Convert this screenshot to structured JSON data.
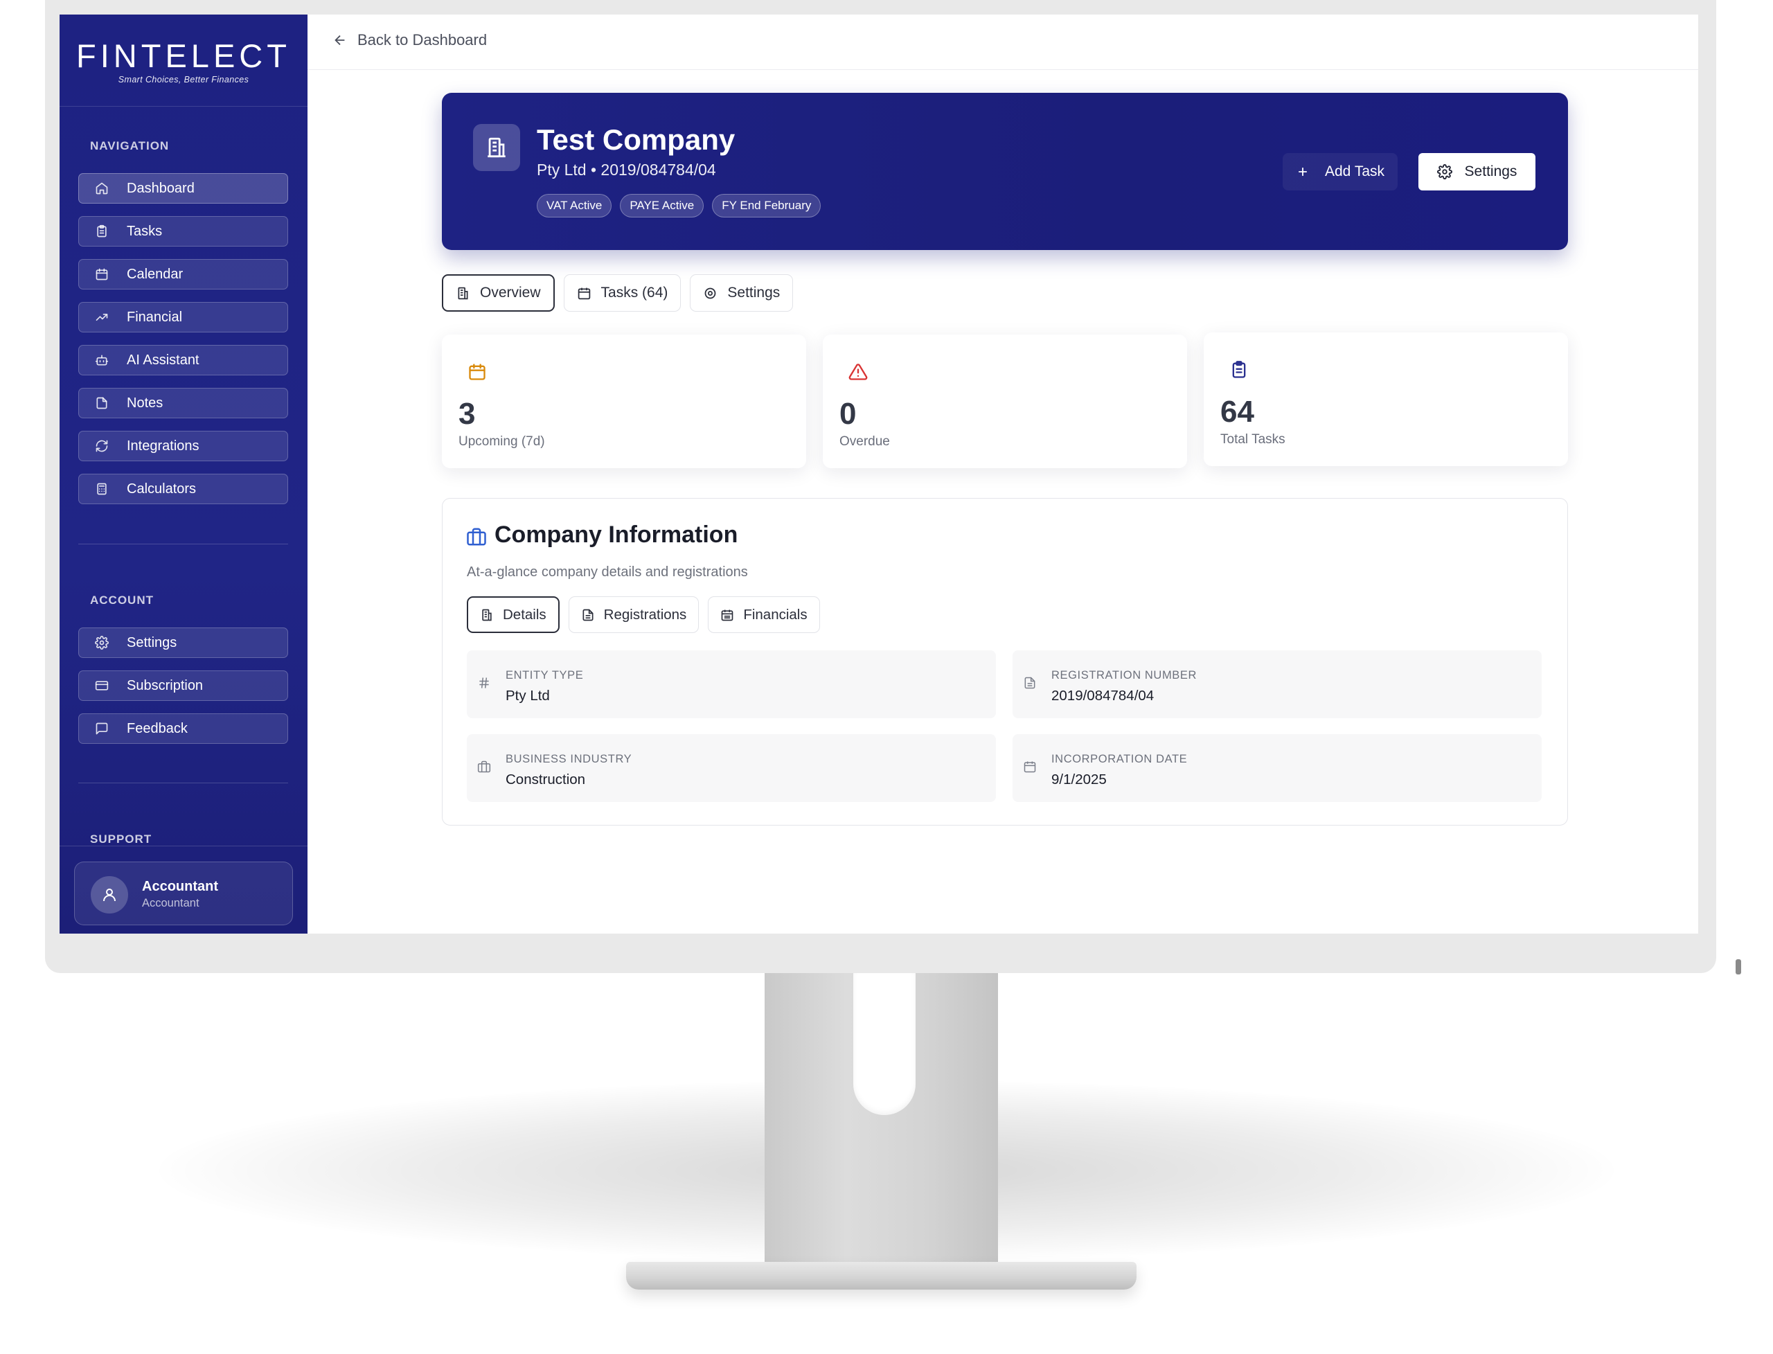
{
  "brand": {
    "name": "FINTELECT",
    "tagline": "Smart Choices, Better Finances"
  },
  "sidebar": {
    "navigation_label": "NAVIGATION",
    "nav_items": [
      {
        "label": "Dashboard",
        "icon": "home-icon",
        "active": true
      },
      {
        "label": "Tasks",
        "icon": "clipboard-icon"
      },
      {
        "label": "Calendar",
        "icon": "calendar-icon"
      },
      {
        "label": "Financial",
        "icon": "trending-up-icon"
      },
      {
        "label": "AI Assistant",
        "icon": "bot-icon"
      },
      {
        "label": "Notes",
        "icon": "file-icon"
      },
      {
        "label": "Integrations",
        "icon": "refresh-icon"
      },
      {
        "label": "Calculators",
        "icon": "calculator-icon"
      }
    ],
    "account_label": "ACCOUNT",
    "account_items": [
      {
        "label": "Settings",
        "icon": "gear-icon"
      },
      {
        "label": "Subscription",
        "icon": "credit-card-icon"
      },
      {
        "label": "Feedback",
        "icon": "message-icon"
      }
    ],
    "support_label": "SUPPORT",
    "user": {
      "name": "Accountant",
      "role": "Accountant"
    }
  },
  "topbar": {
    "back_label": "Back to Dashboard"
  },
  "company": {
    "name": "Test Company",
    "subtitle": "Pty Ltd • 2019/084784/04",
    "badges": [
      "VAT Active",
      "PAYE Active",
      "FY End February"
    ],
    "add_task_label": "Add Task",
    "settings_label": "Settings"
  },
  "tabs": [
    {
      "label": "Overview",
      "icon": "building-icon",
      "active": true
    },
    {
      "label": "Tasks (64)",
      "icon": "calendar-icon"
    },
    {
      "label": "Settings",
      "icon": "gear-icon"
    }
  ],
  "stats": [
    {
      "value": "3",
      "label": "Upcoming (7d)",
      "icon": "calendar-icon",
      "color": "#d98a0b"
    },
    {
      "value": "0",
      "label": "Overdue",
      "icon": "alert-triangle-icon",
      "color": "#d93434"
    },
    {
      "value": "64",
      "label": "Total Tasks",
      "icon": "clipboard-icon",
      "color": "#2b3190"
    }
  ],
  "info": {
    "title": "Company Information",
    "subtitle": "At-a-glance company details and registrations",
    "tabs": [
      {
        "label": "Details",
        "icon": "building-icon",
        "active": true
      },
      {
        "label": "Registrations",
        "icon": "file-text-icon"
      },
      {
        "label": "Financials",
        "icon": "calendar-icon"
      }
    ],
    "fields": [
      {
        "label": "ENTITY TYPE",
        "value": "Pty Ltd",
        "icon": "hash-icon"
      },
      {
        "label": "REGISTRATION NUMBER",
        "value": "2019/084784/04",
        "icon": "file-text-icon"
      },
      {
        "label": "BUSINESS INDUSTRY",
        "value": "Construction",
        "icon": "briefcase-icon"
      },
      {
        "label": "INCORPORATION DATE",
        "value": "9/1/2025",
        "icon": "calendar-icon"
      }
    ]
  },
  "colors": {
    "sidebar": "#1e2282",
    "hero": "#1b1e7a",
    "info_icon": "#2f5fd1"
  }
}
